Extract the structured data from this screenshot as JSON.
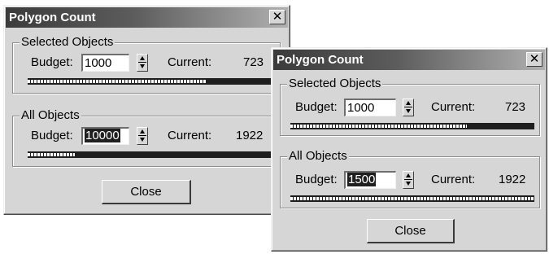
{
  "dialogs": [
    {
      "title": "Polygon Count",
      "close_icon": "close-x-icon",
      "selected": {
        "legend": "Selected Objects",
        "budget_label": "Budget:",
        "budget_value": "1000",
        "current_label": "Current:",
        "current_value": "723",
        "progress": 0.723
      },
      "all": {
        "legend": "All Objects",
        "budget_label": "Budget:",
        "budget_value": "10000",
        "current_label": "Current:",
        "current_value": "1922",
        "progress": 0.19
      },
      "close_button": "Close"
    },
    {
      "title": "Polygon Count",
      "close_icon": "close-x-icon",
      "selected": {
        "legend": "Selected Objects",
        "budget_label": "Budget:",
        "budget_value": "1000",
        "current_label": "Current:",
        "current_value": "723",
        "progress": 0.723
      },
      "all": {
        "legend": "All Objects",
        "budget_label": "Budget:",
        "budget_value": "1500",
        "current_label": "Current:",
        "current_value": "1922",
        "progress": 1.0
      },
      "close_button": "Close"
    }
  ],
  "colors": {
    "title_bar_dark": "#3b3b3b",
    "title_bar_light": "#b0b0b0",
    "dialog_face": "#d6d6d6",
    "progress_track": "#1e1e1e"
  }
}
